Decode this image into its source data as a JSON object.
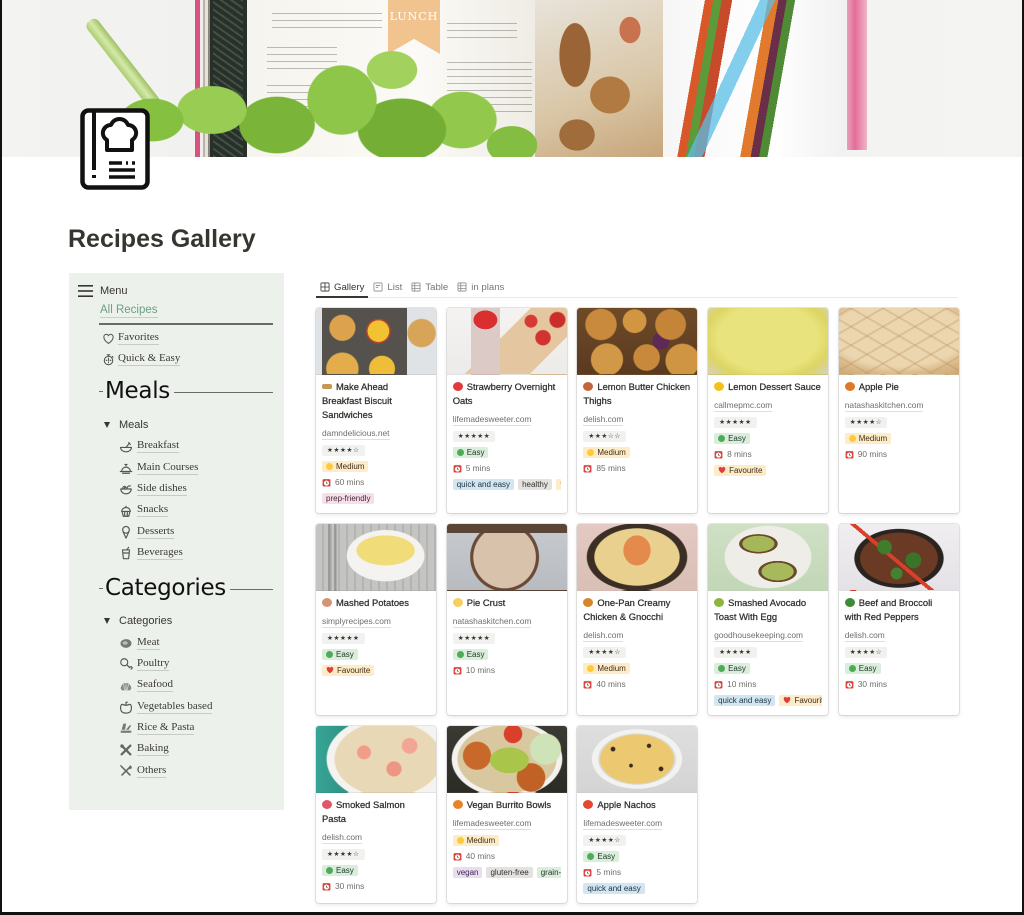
{
  "page": {
    "title": "Recipes Gallery",
    "icon": "recipe-book-chef-hat-icon",
    "cover": {
      "banner_text": "LUNCH"
    }
  },
  "sidebar": {
    "menu_label": "Menu",
    "menu_icon": "hamburger-menu-icon",
    "all_recipes": "All Recipes",
    "quick_links": [
      {
        "label": "Favorites",
        "icon": "heart-outline-icon"
      },
      {
        "label": "Quick & Easy",
        "icon": "stopwatch-icon"
      }
    ],
    "sections": [
      {
        "heading": "Meals",
        "toggle_label": "Meals",
        "items": [
          {
            "label": "Breakfast",
            "icon": "breakfast-bowl-icon"
          },
          {
            "label": "Main Courses",
            "icon": "cloche-icon"
          },
          {
            "label": "Side dishes",
            "icon": "salad-bowl-icon"
          },
          {
            "label": "Snacks",
            "icon": "cupcake-icon"
          },
          {
            "label": "Desserts",
            "icon": "ice-cream-icon"
          },
          {
            "label": "Beverages",
            "icon": "drink-cup-icon"
          }
        ]
      },
      {
        "heading": "Categories",
        "toggle_label": "Categories",
        "items": [
          {
            "label": "Meat",
            "icon": "steak-icon"
          },
          {
            "label": "Poultry",
            "icon": "drumstick-icon"
          },
          {
            "label": "Seafood",
            "icon": "shell-icon"
          },
          {
            "label": "Vegetables based",
            "icon": "bell-pepper-icon"
          },
          {
            "label": "Rice & Pasta",
            "icon": "pasta-icon"
          },
          {
            "label": "Baking",
            "icon": "baking-tools-icon"
          },
          {
            "label": "Others",
            "icon": "fork-knife-icon"
          }
        ]
      }
    ]
  },
  "views": {
    "tabs": [
      {
        "label": "Gallery",
        "icon": "gallery-icon",
        "active": true
      },
      {
        "label": "List",
        "icon": "list-icon",
        "active": false
      },
      {
        "label": "Table",
        "icon": "table-icon",
        "active": false
      },
      {
        "label": "in plans",
        "icon": "table-icon",
        "active": false
      }
    ]
  },
  "colors": {
    "accent_green": "#6c9f80",
    "alarm_red": "#d9453b",
    "heart_red": "#e03e3e",
    "tags": {
      "gray": {
        "bg": "#e3e2e0",
        "fg": "#32302c"
      },
      "yellow": {
        "bg": "#fdecc8",
        "fg": "#402c1b"
      },
      "green": {
        "bg": "#dbeddb",
        "fg": "#1c3829"
      },
      "blue": {
        "bg": "#d3e5ef",
        "fg": "#183347"
      },
      "pink": {
        "bg": "#f5e0e9",
        "fg": "#4c2337"
      },
      "purple": {
        "bg": "#e8deee",
        "fg": "#412454"
      }
    },
    "difficulty": {
      "Easy": {
        "bg": "#dbeddb",
        "fg": "#1c3829",
        "dot": "#4dab5a"
      },
      "Medium": {
        "bg": "#fdecc8",
        "fg": "#402c1b",
        "dot": "#ffc93c"
      }
    }
  },
  "cards": [
    {
      "title": "Make Ahead Breakfast Biscuit Sandwiches",
      "emoji": "bread-loaf-icon",
      "emoji_color": "#c39a55",
      "image": "biscuit-sandwiches-photo",
      "source": "damndelicious.net",
      "stars": "★★★★☆",
      "difficulty": "Medium",
      "time": "60 mins",
      "tags": [
        {
          "label": "prep-friendly",
          "color": "pink"
        }
      ]
    },
    {
      "title": "Strawberry Overnight Oats",
      "emoji": "strawberry-icon",
      "emoji_color": "#e5363b",
      "image": "overnight-oats-photo",
      "source": "lifemadesweeter.com",
      "stars": "★★★★★",
      "difficulty": "Easy",
      "time": "5 mins",
      "tags": [
        {
          "label": "quick and easy",
          "color": "blue"
        },
        {
          "label": "healthy",
          "color": "gray"
        },
        {
          "label": "Favourite",
          "color": "yellow",
          "heart": true
        }
      ]
    },
    {
      "title": "Lemon Butter Chicken Thighs",
      "emoji": "poultry-leg-icon",
      "emoji_color": "#c4643a",
      "image": "lemon-chicken-photo",
      "source": "delish.com",
      "stars": "★★★☆☆",
      "difficulty": "Medium",
      "time": "85 mins",
      "tags": []
    },
    {
      "title": "Lemon Dessert Sauce",
      "emoji": "lemon-icon",
      "emoji_color": "#f2c21b",
      "image": "lemon-sauce-photo",
      "source": "callmepmc.com",
      "stars": "★★★★★",
      "difficulty": "Easy",
      "time": "8 mins",
      "tags": [
        {
          "label": "Favourite",
          "color": "yellow",
          "heart": true
        }
      ]
    },
    {
      "title": "Apple Pie",
      "emoji": "pie-icon",
      "emoji_color": "#e0782a",
      "image": "apple-pie-photo",
      "source": "natashaskitchen.com",
      "stars": "★★★★☆",
      "difficulty": "Medium",
      "time": "90 mins",
      "tags": []
    },
    {
      "title": "Mashed Potatoes",
      "emoji": "potato-icon",
      "emoji_color": "#d39478",
      "image": "mashed-potatoes-photo",
      "source": "simplyrecipes.com",
      "stars": "★★★★★",
      "difficulty": "Easy",
      "time": null,
      "tags": [
        {
          "label": "Favourite",
          "color": "yellow",
          "heart": true
        }
      ]
    },
    {
      "title": "Pie Crust",
      "emoji": "butter-icon",
      "emoji_color": "#f6cf5e",
      "image": "pie-crust-photo",
      "source": "natashaskitchen.com",
      "stars": "★★★★★",
      "difficulty": "Easy",
      "time": "10 mins",
      "tags": []
    },
    {
      "title": "One-Pan Creamy Chicken & Gnocchi",
      "emoji": "shallow-pan-icon",
      "emoji_color": "#d6862a",
      "image": "chicken-gnocchi-photo",
      "source": "delish.com",
      "stars": "★★★★☆",
      "difficulty": "Medium",
      "time": "40 mins",
      "tags": []
    },
    {
      "title": "Smashed Avocado Toast With Egg",
      "emoji": "avocado-icon",
      "emoji_color": "#8db43c",
      "image": "avocado-toast-photo",
      "source": "goodhousekeeping.com",
      "stars": "★★★★★",
      "difficulty": "Easy",
      "time": "10 mins",
      "tags": [
        {
          "label": "quick and easy",
          "color": "blue"
        },
        {
          "label": "Favourite",
          "color": "yellow",
          "heart": true
        }
      ]
    },
    {
      "title": "Beef and Broccoli with Red Peppers",
      "emoji": "broccoli-icon",
      "emoji_color": "#3d8b36",
      "image": "beef-broccoli-photo",
      "source": "delish.com",
      "stars": "★★★★☆",
      "difficulty": "Easy",
      "time": "30 mins",
      "tags": []
    },
    {
      "title": "Smoked Salmon Pasta",
      "emoji": "fish-cake-icon",
      "emoji_color": "#e0566a",
      "image": "salmon-pasta-photo",
      "source": "delish.com",
      "stars": "★★★★☆",
      "difficulty": "Easy",
      "time": "30 mins",
      "tags": []
    },
    {
      "title": "Vegan Burrito Bowls",
      "emoji": "burrito-icon",
      "emoji_color": "#e8832a",
      "image": "burrito-bowl-photo",
      "source": "lifemadesweeter.com",
      "stars": null,
      "difficulty": "Medium",
      "time": "40 mins",
      "tags": [
        {
          "label": "vegan",
          "color": "purple"
        },
        {
          "label": "gluten-free",
          "color": "gray"
        },
        {
          "label": "grain-free",
          "color": "green"
        }
      ]
    },
    {
      "title": "Apple Nachos",
      "emoji": "apple-icon",
      "emoji_color": "#e4472f",
      "image": "apple-nachos-photo",
      "source": "lifemadesweeter.com",
      "stars": "★★★★☆",
      "difficulty": "Easy",
      "time": "5 mins",
      "tags": [
        {
          "label": "quick and easy",
          "color": "blue"
        }
      ]
    }
  ]
}
